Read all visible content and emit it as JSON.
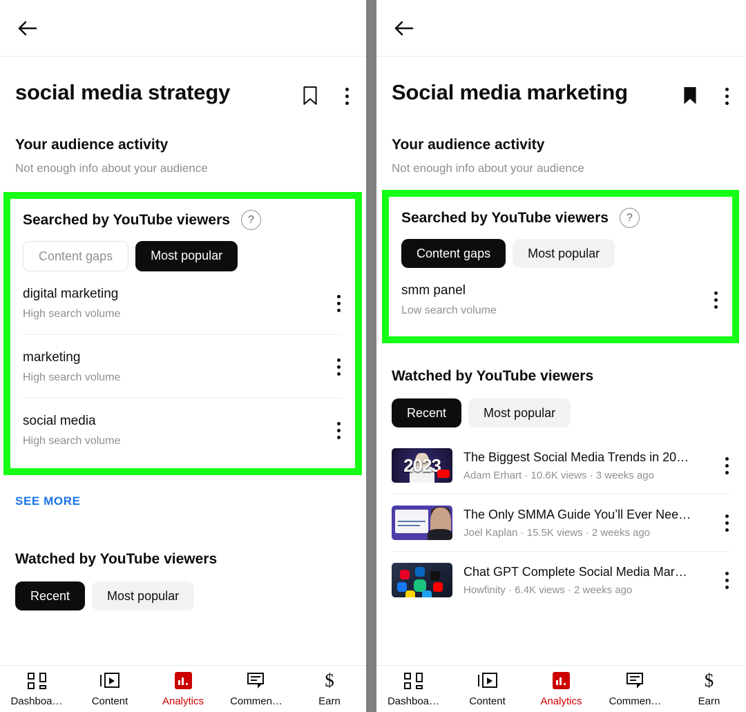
{
  "colors": {
    "highlight_green": "#16ff16",
    "accent_red": "#cc0000",
    "link_blue": "#1a73e8",
    "chip_selected_bg": "#0d0d0d",
    "chip_unselected_bg": "#f2f2f2",
    "divider_gray": "#808080"
  },
  "left": {
    "back_label": "Back",
    "title": "social media strategy",
    "bookmark_state": "not-saved",
    "audience": {
      "heading": "Your audience activity",
      "message": "Not enough info about your audience"
    },
    "searched": {
      "heading": "Searched by YouTube viewers",
      "help_glyph": "?",
      "chips": [
        {
          "label": "Content gaps",
          "selected": false,
          "style": "outline"
        },
        {
          "label": "Most popular",
          "selected": true,
          "style": "selected"
        }
      ],
      "keywords": [
        {
          "name": "digital marketing",
          "volume": "High search volume"
        },
        {
          "name": "marketing",
          "volume": "High search volume"
        },
        {
          "name": "social media",
          "volume": "High search volume"
        }
      ],
      "see_more": "SEE MORE"
    },
    "watched": {
      "heading": "Watched by YouTube viewers",
      "chips": [
        {
          "label": "Recent",
          "selected": true
        },
        {
          "label": "Most popular",
          "selected": false
        }
      ]
    },
    "bottom_nav": [
      {
        "label": "Dashboa…",
        "icon": "dashboard-icon",
        "active": false
      },
      {
        "label": "Content",
        "icon": "content-icon",
        "active": false
      },
      {
        "label": "Analytics",
        "icon": "analytics-icon",
        "active": true
      },
      {
        "label": "Commen…",
        "icon": "comments-icon",
        "active": false
      },
      {
        "label": "Earn",
        "icon": "earn-icon",
        "active": false
      }
    ]
  },
  "right": {
    "back_label": "Back",
    "title": "Social media marketing",
    "bookmark_state": "saved",
    "audience": {
      "heading": "Your audience activity",
      "message": "Not enough info about your audience"
    },
    "searched": {
      "heading": "Searched by YouTube viewers",
      "help_glyph": "?",
      "chips": [
        {
          "label": "Content gaps",
          "selected": true,
          "style": "selected"
        },
        {
          "label": "Most popular",
          "selected": false,
          "style": "unselected"
        }
      ],
      "keywords": [
        {
          "name": "smm panel",
          "volume": "Low search volume"
        }
      ]
    },
    "watched": {
      "heading": "Watched by YouTube viewers",
      "chips": [
        {
          "label": "Recent",
          "selected": true
        },
        {
          "label": "Most popular",
          "selected": false
        }
      ],
      "videos": [
        {
          "title": "The Biggest Social Media Trends in 20…",
          "meta": "Adam Erhart · 10.6K views · 3 weeks ago",
          "channel": "Adam Erhart",
          "views": "10.6K views",
          "age": "3 weeks ago"
        },
        {
          "title": "The Only SMMA Guide You’ll Ever Nee…",
          "meta": "Joel Kaplan · 15.5K views · 2 weeks ago",
          "channel": "Joel Kaplan",
          "views": "15.5K views",
          "age": "2 weeks ago"
        },
        {
          "title": "Chat GPT Complete Social Media Mar…",
          "meta": "Howfinity · 6.4K views · 2 weeks ago",
          "channel": "Howfinity",
          "views": "6.4K views",
          "age": "2 weeks ago"
        }
      ]
    },
    "bottom_nav": [
      {
        "label": "Dashboa…",
        "icon": "dashboard-icon",
        "active": false
      },
      {
        "label": "Content",
        "icon": "content-icon",
        "active": false
      },
      {
        "label": "Analytics",
        "icon": "analytics-icon",
        "active": true
      },
      {
        "label": "Commen…",
        "icon": "comments-icon",
        "active": false
      },
      {
        "label": "Earn",
        "icon": "earn-icon",
        "active": false
      }
    ]
  }
}
